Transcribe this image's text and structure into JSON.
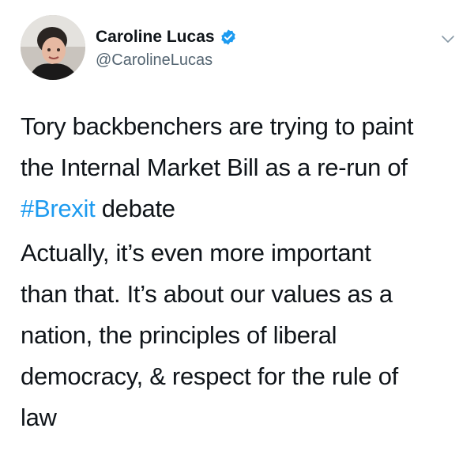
{
  "author": {
    "display_name": "Caroline Lucas",
    "handle": "@CarolineLucas",
    "verified_icon": "verified-badge-icon",
    "avatar_icon": "profile-photo"
  },
  "tweet": {
    "para1": {
      "line1": "Tory backbenchers are trying to paint",
      "line2": "the Internal Market Bill as a re-run of",
      "hashtag": "#Brexit",
      "line3_rest": " debate"
    },
    "para2": {
      "line1": "Actually, it’s even more important",
      "line2": "than that. It’s about our values as a",
      "line3": "nation, the principles of liberal",
      "line4": "democracy, & respect for the rule of",
      "line5": "law"
    }
  },
  "menu_icon": "chevron-down-icon",
  "colors": {
    "text": "#0f1419",
    "secondary": "#536471",
    "accent": "#1d9bf0"
  }
}
